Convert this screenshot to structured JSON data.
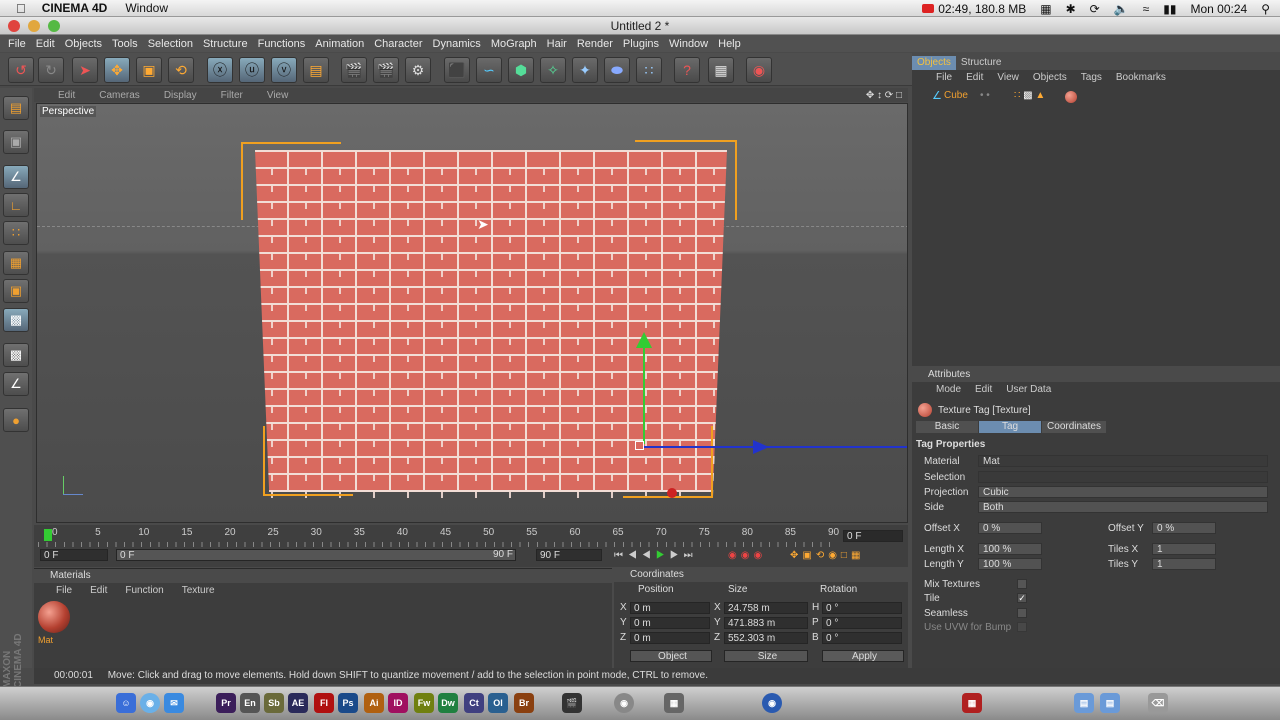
{
  "mac": {
    "app": "CINEMA 4D",
    "window_menu": "Window",
    "status": "02:49, 180.8 MB",
    "clock": "Mon 00:24"
  },
  "window": {
    "title": "Untitled 2 *"
  },
  "menu": [
    "File",
    "Edit",
    "Objects",
    "Tools",
    "Selection",
    "Structure",
    "Functions",
    "Animation",
    "Character",
    "Dynamics",
    "MoGraph",
    "Hair",
    "Render",
    "Plugins",
    "Window",
    "Help"
  ],
  "viewport": {
    "menu": [
      "Edit",
      "Cameras",
      "Display",
      "Filter",
      "View"
    ],
    "label": "Perspective"
  },
  "timeline": {
    "ticks": [
      "0",
      "5",
      "10",
      "15",
      "20",
      "25",
      "30",
      "35",
      "40",
      "45",
      "50",
      "55",
      "60",
      "65",
      "70",
      "75",
      "80",
      "85",
      "90"
    ],
    "frame_box": "0 F",
    "start": "0 F",
    "slider": "0 F",
    "end_a": "90 F",
    "end_b": "90 F"
  },
  "materials": {
    "title": "Materials",
    "menu": [
      "File",
      "Edit",
      "Function",
      "Texture"
    ],
    "mat_name": "Mat"
  },
  "coords": {
    "title": "Coordinates",
    "cols": [
      "Position",
      "Size",
      "Rotation"
    ],
    "rows": [
      {
        "a": "X",
        "pos": "0 m",
        "b": "X",
        "size": "24.758 m",
        "c": "H",
        "rot": "0 °"
      },
      {
        "a": "Y",
        "pos": "0 m",
        "b": "Y",
        "size": "471.883 m",
        "c": "P",
        "rot": "0 °"
      },
      {
        "a": "Z",
        "pos": "0 m",
        "b": "Z",
        "size": "552.303 m",
        "c": "B",
        "rot": "0 °"
      }
    ],
    "mode1": "Object",
    "mode2": "Size",
    "apply": "Apply"
  },
  "objects": {
    "tabs": [
      "Objects",
      "Structure"
    ],
    "menu": [
      "File",
      "Edit",
      "View",
      "Objects",
      "Tags",
      "Bookmarks"
    ],
    "item": "Cube"
  },
  "attributes": {
    "title": "Attributes",
    "menu": [
      "Mode",
      "Edit",
      "User Data"
    ],
    "heading": "Texture Tag [Texture]",
    "tabs": [
      "Basic",
      "Tag",
      "Coordinates"
    ],
    "section": "Tag Properties",
    "material_label": "Material",
    "material_value": "Mat",
    "selection_label": "Selection",
    "projection_label": "Projection",
    "projection_value": "Cubic",
    "side_label": "Side",
    "side_value": "Both",
    "offx_label": "Offset X",
    "offx": "0 %",
    "offy_label": "Offset Y",
    "offy": "0 %",
    "lenx_label": "Length X",
    "lenx": "100 %",
    "tilesx_label": "Tiles X",
    "tilesx": "1",
    "leny_label": "Length Y",
    "leny": "100 %",
    "tilesy_label": "Tiles Y",
    "tilesy": "1",
    "mix_label": "Mix Textures",
    "tile_label": "Tile",
    "seamless_label": "Seamless",
    "uvw_label": "Use UVW for Bump"
  },
  "status": {
    "time": "00:00:01",
    "text": "Move: Click and drag to move elements. Hold down SHIFT to quantize movement / add to the selection in point mode, CTRL to remove."
  },
  "dock": [
    "Pr",
    "En",
    "Sb",
    "AE",
    "Fl",
    "Ps",
    "Ai",
    "ID",
    "Fw",
    "Dw",
    "Ct",
    "Ol",
    "Br"
  ]
}
